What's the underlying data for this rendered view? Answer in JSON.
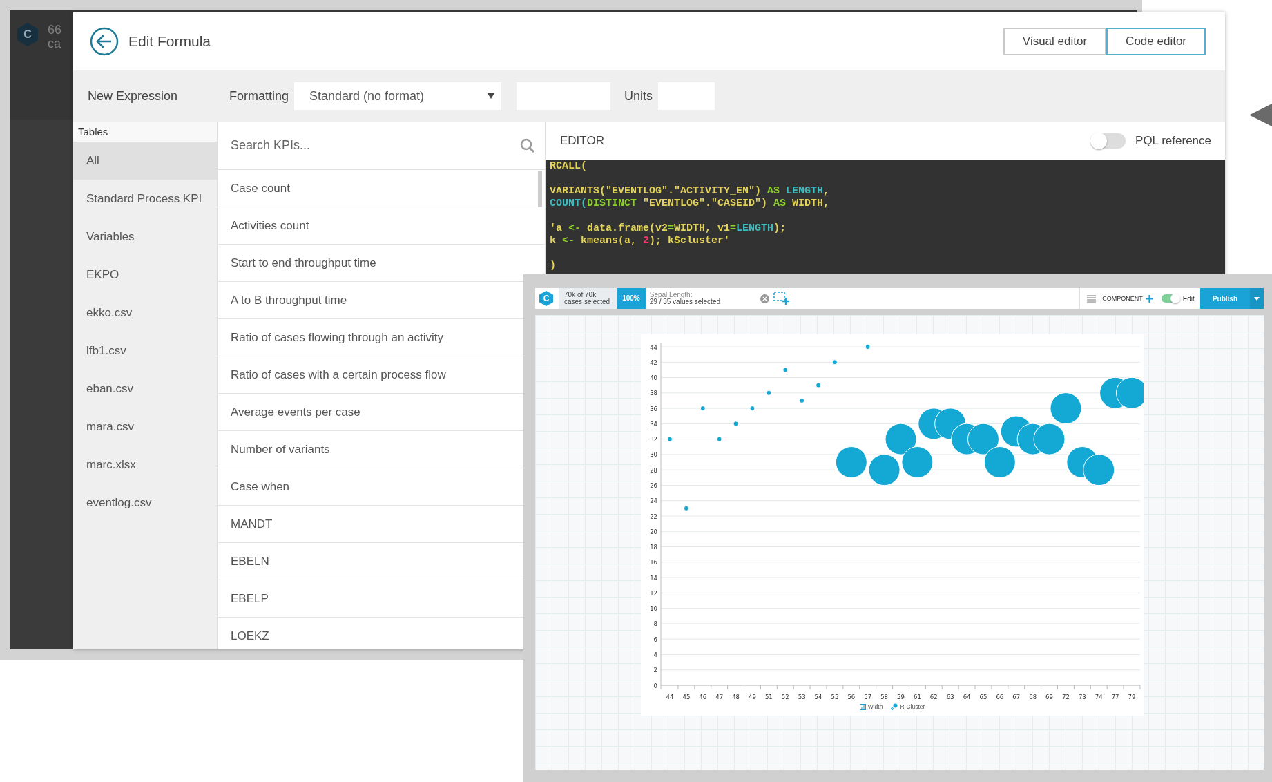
{
  "back_window": {
    "logo": "C",
    "header_texts": [
      "66",
      "ca"
    ]
  },
  "modal": {
    "title": "Edit Formula",
    "editor_modes": [
      {
        "label": "Visual editor",
        "selected": false
      },
      {
        "label": "Code editor",
        "selected": true
      }
    ]
  },
  "toolbar": {
    "name": "New Expression",
    "formatting_label": "Formatting",
    "formatting": {
      "value": "Standard (no format)"
    },
    "units_label": "Units"
  },
  "tables": {
    "heading": "Tables",
    "items": [
      {
        "label": "All",
        "selected": true
      },
      {
        "label": "Standard Process KPI",
        "selected": false
      },
      {
        "label": "Variables",
        "selected": false
      },
      {
        "label": "EKPO",
        "selected": false
      },
      {
        "label": "ekko.csv",
        "selected": false
      },
      {
        "label": "lfb1.csv",
        "selected": false
      },
      {
        "label": "eban.csv",
        "selected": false
      },
      {
        "label": "mara.csv",
        "selected": false
      },
      {
        "label": "marc.xlsx",
        "selected": false
      },
      {
        "label": "eventlog.csv",
        "selected": false
      }
    ]
  },
  "kpi_search": {
    "placeholder": "Search KPIs..."
  },
  "kpis": [
    "Case count",
    "Activities count",
    "Start to end throughput time",
    "A to B throughput time",
    "Ratio of cases flowing through an activity",
    "Ratio of cases with a certain process flow",
    "Average events per case",
    "Number of variants",
    "Case when",
    "MANDT",
    "EBELN",
    "EBELP",
    "LOEKZ"
  ],
  "editor": {
    "heading": "EDITOR",
    "pql_reference": {
      "label": "PQL reference",
      "on": false
    },
    "code_lines": [
      {
        "kind": "code",
        "tokens": [
          {
            "text": "RCALL(",
            "kind": "text"
          }
        ]
      },
      {
        "kind": "blank"
      },
      {
        "kind": "code",
        "tokens": [
          {
            "text": "VARIANTS(\"EVENTLOG\".\"ACTIVITY_EN\")",
            "kind": "text"
          },
          {
            "text": " AS ",
            "kind": "keyword"
          },
          {
            "text": "LENGTH",
            "kind": "name"
          },
          {
            "text": ",",
            "kind": "text"
          }
        ]
      },
      {
        "kind": "code",
        "tokens": [
          {
            "text": "COUNT(",
            "kind": "name"
          },
          {
            "text": "DISTINCT",
            "kind": "keyword"
          },
          {
            "text": " \"EVENTLOG\".\"CASEID\")",
            "kind": "text"
          },
          {
            "text": " AS ",
            "kind": "keyword"
          },
          {
            "text": "WIDTH,",
            "kind": "text"
          }
        ]
      },
      {
        "kind": "blank"
      },
      {
        "kind": "code",
        "tokens": [
          {
            "text": "'a ",
            "kind": "text"
          },
          {
            "text": "<-",
            "kind": "keyword"
          },
          {
            "text": " data.frame(v2",
            "kind": "text"
          },
          {
            "text": "=",
            "kind": "keyword"
          },
          {
            "text": "WIDTH, v1",
            "kind": "text"
          },
          {
            "text": "=",
            "kind": "keyword"
          },
          {
            "text": "LENGTH",
            "kind": "name"
          },
          {
            "text": ");",
            "kind": "text"
          }
        ]
      },
      {
        "kind": "code",
        "tokens": [
          {
            "text": "k ",
            "kind": "text"
          },
          {
            "text": "<-",
            "kind": "keyword"
          },
          {
            "text": " kmeans(a, ",
            "kind": "text"
          },
          {
            "text": "2",
            "kind": "number"
          },
          {
            "text": "); k$cluster'",
            "kind": "text"
          }
        ]
      },
      {
        "kind": "blank"
      },
      {
        "kind": "code",
        "tokens": [
          {
            "text": ")",
            "kind": "text"
          }
        ]
      }
    ]
  },
  "dashboard": {
    "logo": "C",
    "selection": {
      "count": "70k of 70k",
      "caption": "cases selected",
      "percent": "100%"
    },
    "filter": {
      "field": "Sepal.Length:",
      "summary": "29 / 35 values selected"
    },
    "component_label": "COMPONENT",
    "edit": {
      "label": "Edit",
      "on": true
    },
    "publish": "Publish",
    "chart_data": {
      "type": "scatter",
      "categories": [
        "44",
        "45",
        "46",
        "47",
        "48",
        "49",
        "51",
        "52",
        "53",
        "54",
        "55",
        "56",
        "57",
        "58",
        "59",
        "61",
        "62",
        "63",
        "64",
        "65",
        "66",
        "67",
        "68",
        "69",
        "72",
        "73",
        "74",
        "77",
        "79"
      ],
      "series": [
        {
          "name": "Width",
          "color": "#14a8d4",
          "values": [
            32,
            23,
            36,
            32,
            34,
            36,
            38,
            41,
            37,
            39,
            42,
            null,
            44,
            null,
            null,
            null,
            null,
            null,
            null,
            null,
            null,
            null,
            null,
            null,
            null,
            null,
            null,
            null,
            null
          ]
        },
        {
          "name": "R-Cluster",
          "color": "#14a8d4",
          "values": [
            null,
            null,
            null,
            null,
            null,
            null,
            null,
            null,
            null,
            null,
            null,
            29,
            null,
            28,
            32,
            29,
            34,
            34,
            32,
            32,
            29,
            33,
            32,
            32,
            36,
            29,
            28,
            38,
            38
          ]
        }
      ],
      "grid": true,
      "ylim": [
        0,
        44
      ],
      "yticks": [
        0,
        2,
        4,
        6,
        8,
        10,
        12,
        14,
        16,
        18,
        20,
        22,
        24,
        26,
        28,
        30,
        32,
        34,
        36,
        38,
        40,
        42,
        44
      ]
    }
  }
}
